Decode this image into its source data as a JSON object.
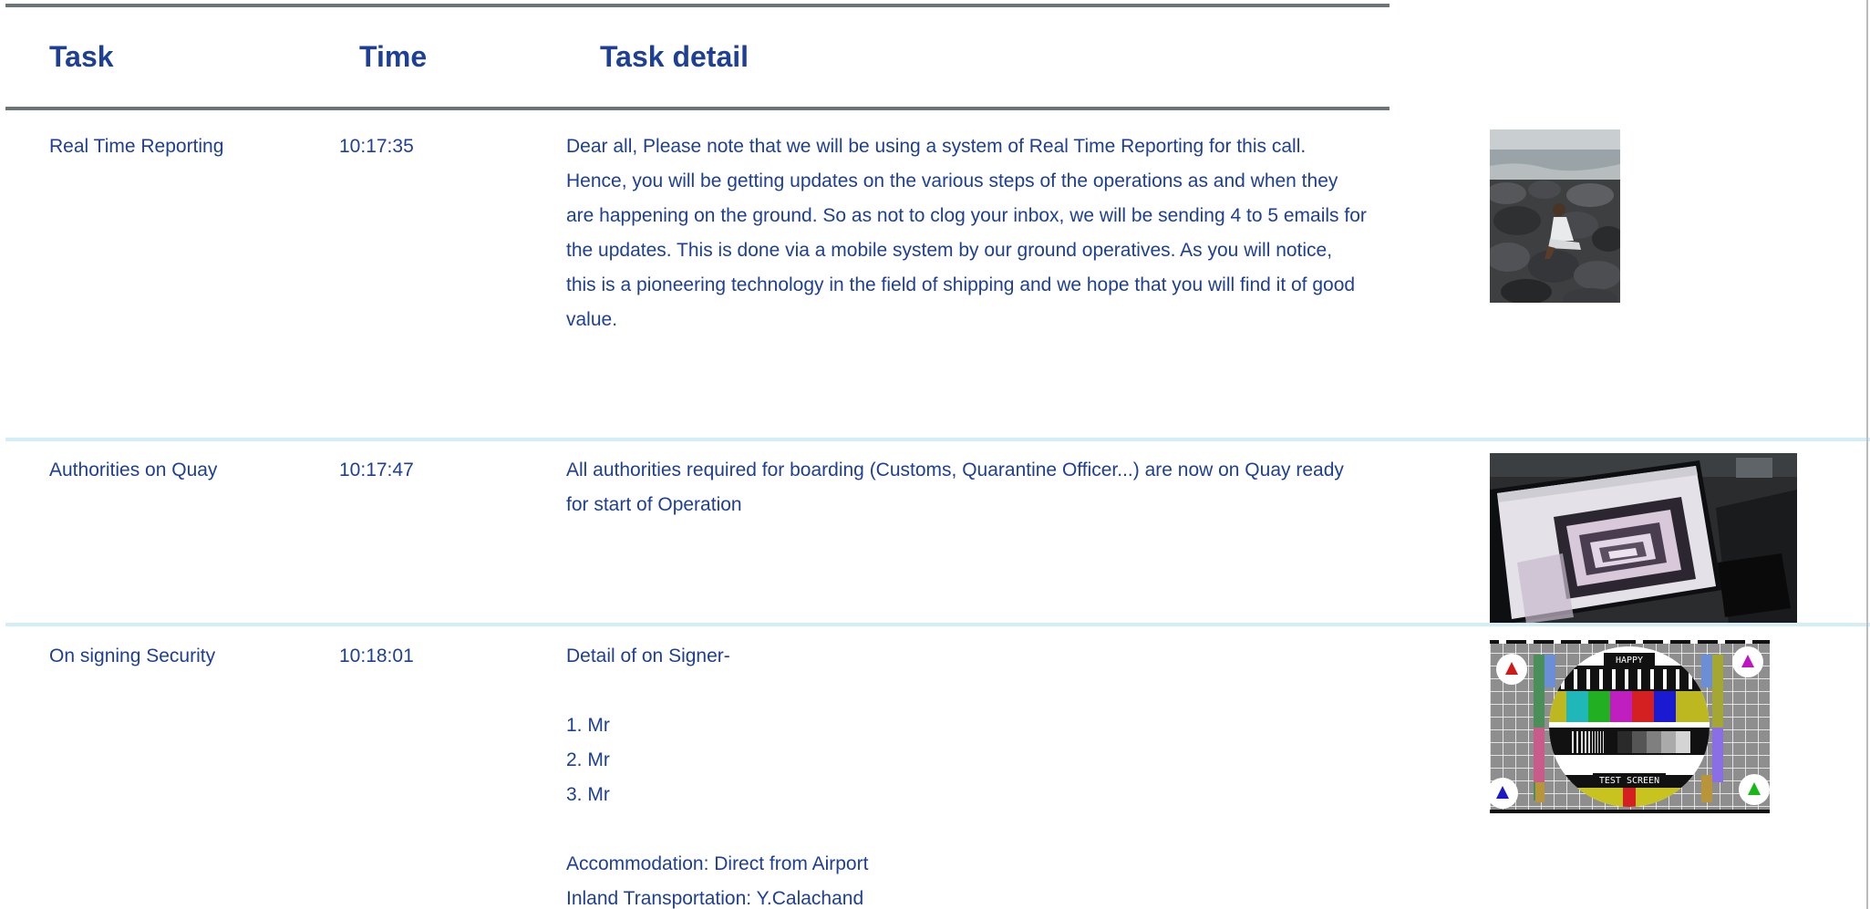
{
  "table": {
    "headers": {
      "task": "Task",
      "time": "Time",
      "detail": "Task detail"
    },
    "rows": [
      {
        "task": "Real Time Reporting",
        "time": "10:17:35",
        "detail_lines": [
          "Dear all, Please note that we will be using a system of Real Time Reporting for this call.",
          "Hence, you will be getting updates on the various steps of the operations as and when they",
          "are happening on the ground. So as not to clog your inbox, we will be sending 4 to 5 emails for",
          "the updates. This is done via a mobile system by our ground operatives. As you will notice,",
          "this is a pioneering technology in the  field of shipping and we hope that you will find it of good",
          "value."
        ]
      },
      {
        "task": "Authorities on Quay",
        "time": "10:17:47",
        "detail_lines": [
          "All authorities required for boarding (Customs, Quarantine Officer...) are now on Quay ready",
          "for start of Operation"
        ]
      },
      {
        "task": "On signing Security",
        "time": "10:18:01",
        "detail_lines": [
          "Detail of on Signer-",
          "",
          "1. Mr",
          "2. Mr",
          "3. Mr",
          "",
          "Accommodation: Direct from Airport",
          "Inland Transportation: Y.Calachand"
        ]
      }
    ]
  },
  "images": {
    "test_screen_top_label": "HAPPY",
    "test_screen_bottom_label": "TEST SCREEN"
  }
}
